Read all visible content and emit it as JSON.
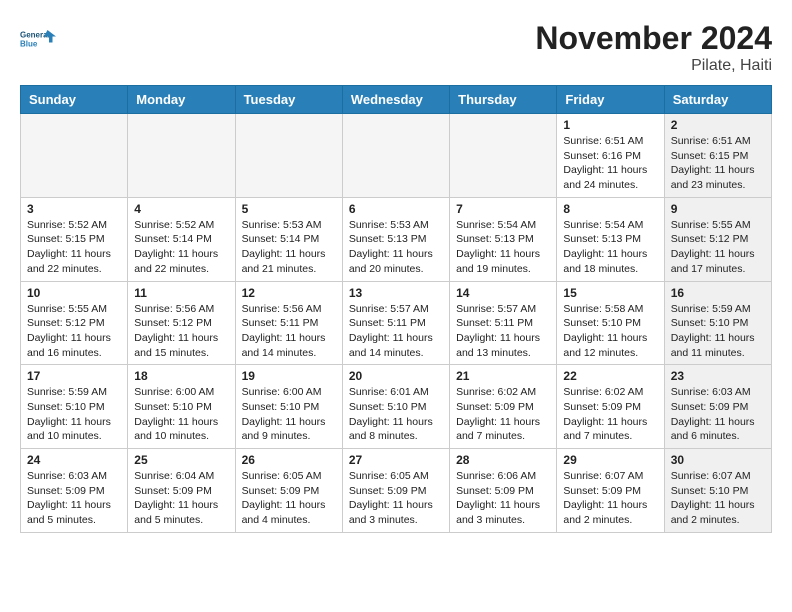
{
  "header": {
    "logo_line1": "General",
    "logo_line2": "Blue",
    "month": "November 2024",
    "location": "Pilate, Haiti"
  },
  "weekdays": [
    "Sunday",
    "Monday",
    "Tuesday",
    "Wednesday",
    "Thursday",
    "Friday",
    "Saturday"
  ],
  "weeks": [
    [
      {
        "day": "",
        "info": "",
        "empty": true
      },
      {
        "day": "",
        "info": "",
        "empty": true
      },
      {
        "day": "",
        "info": "",
        "empty": true
      },
      {
        "day": "",
        "info": "",
        "empty": true
      },
      {
        "day": "",
        "info": "",
        "empty": true
      },
      {
        "day": "1",
        "info": "Sunrise: 6:51 AM\nSunset: 6:16 PM\nDaylight: 11 hours\nand 24 minutes.",
        "shaded": false
      },
      {
        "day": "2",
        "info": "Sunrise: 6:51 AM\nSunset: 6:15 PM\nDaylight: 11 hours\nand 23 minutes.",
        "shaded": true
      }
    ],
    [
      {
        "day": "3",
        "info": "Sunrise: 5:52 AM\nSunset: 5:15 PM\nDaylight: 11 hours\nand 22 minutes.",
        "shaded": false
      },
      {
        "day": "4",
        "info": "Sunrise: 5:52 AM\nSunset: 5:14 PM\nDaylight: 11 hours\nand 22 minutes.",
        "shaded": false
      },
      {
        "day": "5",
        "info": "Sunrise: 5:53 AM\nSunset: 5:14 PM\nDaylight: 11 hours\nand 21 minutes.",
        "shaded": false
      },
      {
        "day": "6",
        "info": "Sunrise: 5:53 AM\nSunset: 5:13 PM\nDaylight: 11 hours\nand 20 minutes.",
        "shaded": false
      },
      {
        "day": "7",
        "info": "Sunrise: 5:54 AM\nSunset: 5:13 PM\nDaylight: 11 hours\nand 19 minutes.",
        "shaded": false
      },
      {
        "day": "8",
        "info": "Sunrise: 5:54 AM\nSunset: 5:13 PM\nDaylight: 11 hours\nand 18 minutes.",
        "shaded": false
      },
      {
        "day": "9",
        "info": "Sunrise: 5:55 AM\nSunset: 5:12 PM\nDaylight: 11 hours\nand 17 minutes.",
        "shaded": true
      }
    ],
    [
      {
        "day": "10",
        "info": "Sunrise: 5:55 AM\nSunset: 5:12 PM\nDaylight: 11 hours\nand 16 minutes.",
        "shaded": false
      },
      {
        "day": "11",
        "info": "Sunrise: 5:56 AM\nSunset: 5:12 PM\nDaylight: 11 hours\nand 15 minutes.",
        "shaded": false
      },
      {
        "day": "12",
        "info": "Sunrise: 5:56 AM\nSunset: 5:11 PM\nDaylight: 11 hours\nand 14 minutes.",
        "shaded": false
      },
      {
        "day": "13",
        "info": "Sunrise: 5:57 AM\nSunset: 5:11 PM\nDaylight: 11 hours\nand 14 minutes.",
        "shaded": false
      },
      {
        "day": "14",
        "info": "Sunrise: 5:57 AM\nSunset: 5:11 PM\nDaylight: 11 hours\nand 13 minutes.",
        "shaded": false
      },
      {
        "day": "15",
        "info": "Sunrise: 5:58 AM\nSunset: 5:10 PM\nDaylight: 11 hours\nand 12 minutes.",
        "shaded": false
      },
      {
        "day": "16",
        "info": "Sunrise: 5:59 AM\nSunset: 5:10 PM\nDaylight: 11 hours\nand 11 minutes.",
        "shaded": true
      }
    ],
    [
      {
        "day": "17",
        "info": "Sunrise: 5:59 AM\nSunset: 5:10 PM\nDaylight: 11 hours\nand 10 minutes.",
        "shaded": false
      },
      {
        "day": "18",
        "info": "Sunrise: 6:00 AM\nSunset: 5:10 PM\nDaylight: 11 hours\nand 10 minutes.",
        "shaded": false
      },
      {
        "day": "19",
        "info": "Sunrise: 6:00 AM\nSunset: 5:10 PM\nDaylight: 11 hours\nand 9 minutes.",
        "shaded": false
      },
      {
        "day": "20",
        "info": "Sunrise: 6:01 AM\nSunset: 5:10 PM\nDaylight: 11 hours\nand 8 minutes.",
        "shaded": false
      },
      {
        "day": "21",
        "info": "Sunrise: 6:02 AM\nSunset: 5:09 PM\nDaylight: 11 hours\nand 7 minutes.",
        "shaded": false
      },
      {
        "day": "22",
        "info": "Sunrise: 6:02 AM\nSunset: 5:09 PM\nDaylight: 11 hours\nand 7 minutes.",
        "shaded": false
      },
      {
        "day": "23",
        "info": "Sunrise: 6:03 AM\nSunset: 5:09 PM\nDaylight: 11 hours\nand 6 minutes.",
        "shaded": true
      }
    ],
    [
      {
        "day": "24",
        "info": "Sunrise: 6:03 AM\nSunset: 5:09 PM\nDaylight: 11 hours\nand 5 minutes.",
        "shaded": false
      },
      {
        "day": "25",
        "info": "Sunrise: 6:04 AM\nSunset: 5:09 PM\nDaylight: 11 hours\nand 5 minutes.",
        "shaded": false
      },
      {
        "day": "26",
        "info": "Sunrise: 6:05 AM\nSunset: 5:09 PM\nDaylight: 11 hours\nand 4 minutes.",
        "shaded": false
      },
      {
        "day": "27",
        "info": "Sunrise: 6:05 AM\nSunset: 5:09 PM\nDaylight: 11 hours\nand 3 minutes.",
        "shaded": false
      },
      {
        "day": "28",
        "info": "Sunrise: 6:06 AM\nSunset: 5:09 PM\nDaylight: 11 hours\nand 3 minutes.",
        "shaded": false
      },
      {
        "day": "29",
        "info": "Sunrise: 6:07 AM\nSunset: 5:09 PM\nDaylight: 11 hours\nand 2 minutes.",
        "shaded": false
      },
      {
        "day": "30",
        "info": "Sunrise: 6:07 AM\nSunset: 5:10 PM\nDaylight: 11 hours\nand 2 minutes.",
        "shaded": true
      }
    ]
  ]
}
